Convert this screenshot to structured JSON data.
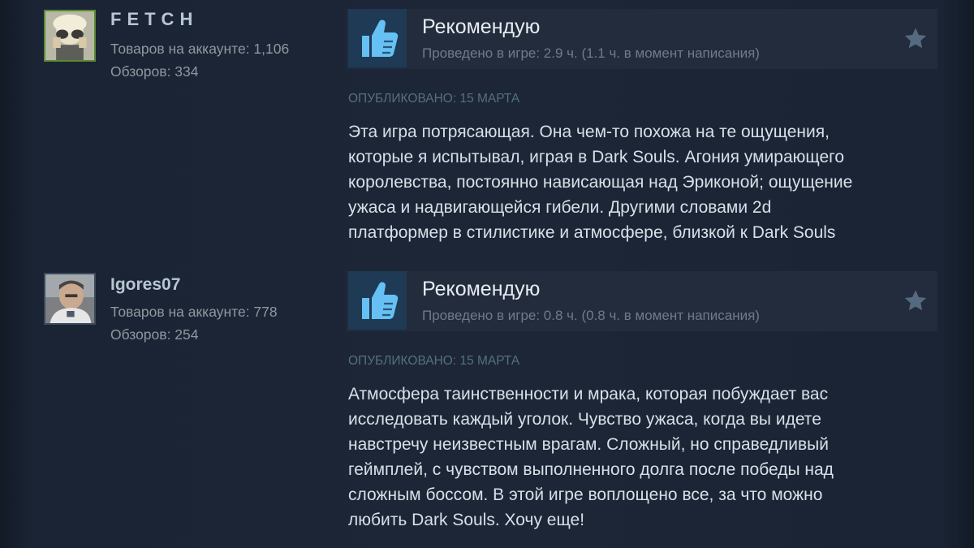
{
  "reviews": [
    {
      "author": {
        "name": "FETCH",
        "products_label": "Товаров на аккаунте: 1,106",
        "reviews_label": "Обзоров: 334"
      },
      "verdict": "Рекомендую",
      "playtime": "Проведено в игре: 2.9 ч. (1.1 ч. в момент написания)",
      "posted": "Опубликовано: 15 марта",
      "body_lines": [
        "Эта игра потрясающая. Она чем-то похожа на те ощущения,",
        "которые я испытывал, играя в Dark Souls. Агония умирающего",
        "королевства, постоянно нависающая над Эриконой; ощущение",
        "ужаса и надвигающейся гибели. Другими словами 2d",
        "платформер в стилистике и атмосфере, близкой к Dark Souls"
      ]
    },
    {
      "author": {
        "name": "Igores07",
        "products_label": "Товаров на аккаунте: 778",
        "reviews_label": "Обзоров: 254"
      },
      "verdict": "Рекомендую",
      "playtime": "Проведено в игре: 0.8 ч. (0.8 ч. в момент написания)",
      "posted": "Опубликовано: 15 марта",
      "body_lines": [
        "Атмосфера таинственности и мрака, которая побуждает вас",
        "исследовать каждый уголок. Чувство ужаса, когда вы идете",
        "навстречу неизвестным врагам. Сложный, но справедливый",
        "геймплей, с чувством выполненного долга после победы над",
        "сложным боссом. В этой игре воплощено все, за что можно",
        "любить Dark Souls. Хочу еще!"
      ]
    }
  ],
  "icons": {
    "thumb": "thumbs-up-icon",
    "award": "star-icon"
  },
  "colors": {
    "background": "#1c2636",
    "header_bg": "#222c3c",
    "thumb_bg": "#1e3a54",
    "thumb": "#66c0f4",
    "muted": "#6f7c88"
  }
}
